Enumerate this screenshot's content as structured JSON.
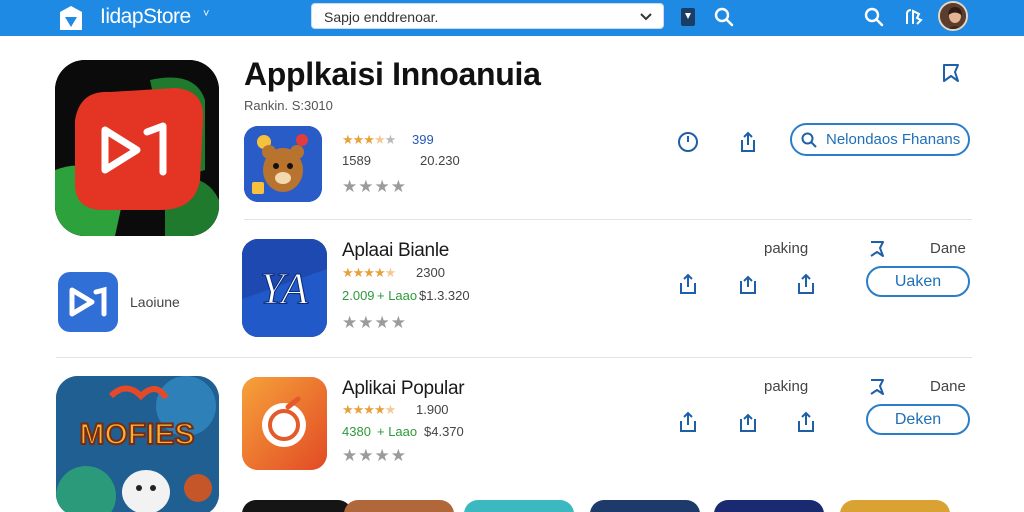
{
  "topbar": {
    "brand_name": "IidapStore",
    "brand_caret": "˅",
    "search_text": "Sapjo enddrenoar.",
    "icons": [
      "store-logo-icon",
      "chevron-down-icon",
      "bookmark-icon",
      "search-icon",
      "search-icon",
      "notification-icon",
      "avatar"
    ]
  },
  "hero": {
    "title": "Applkaisi Innoanuia",
    "subtitle": "Rankin. S:3010"
  },
  "featured_row": {
    "rating_value": "399",
    "left_value": "1589",
    "right_value": "20.230",
    "button_label": "Nelondaos Fhanans",
    "stars_filled": 3.5
  },
  "side_item": {
    "label": "Laoiune"
  },
  "rows": [
    {
      "name": "Aplaai Bianle",
      "rating_value": "2300",
      "green_left": "2.009",
      "green_right": "+ Laao",
      "price": "$1.3.320",
      "meta_label": "paking",
      "meta_right": "Dane",
      "button_label": "Uaken",
      "stars_filled": 4.5
    },
    {
      "name": "Aplikai Popular",
      "rating_value": "1.900",
      "green_left": "4380",
      "green_right": "+ Laao",
      "price": "$4.370",
      "meta_label": "paking",
      "meta_right": "Dane",
      "button_label": "Deken",
      "stars_filled": 4.5
    }
  ],
  "thumb_app_text": "MOFIES",
  "colors": {
    "topbar": "#1f8ae3",
    "accent": "#2a7ec8",
    "star": "#e8a03a",
    "green": "#2d9a3a"
  }
}
